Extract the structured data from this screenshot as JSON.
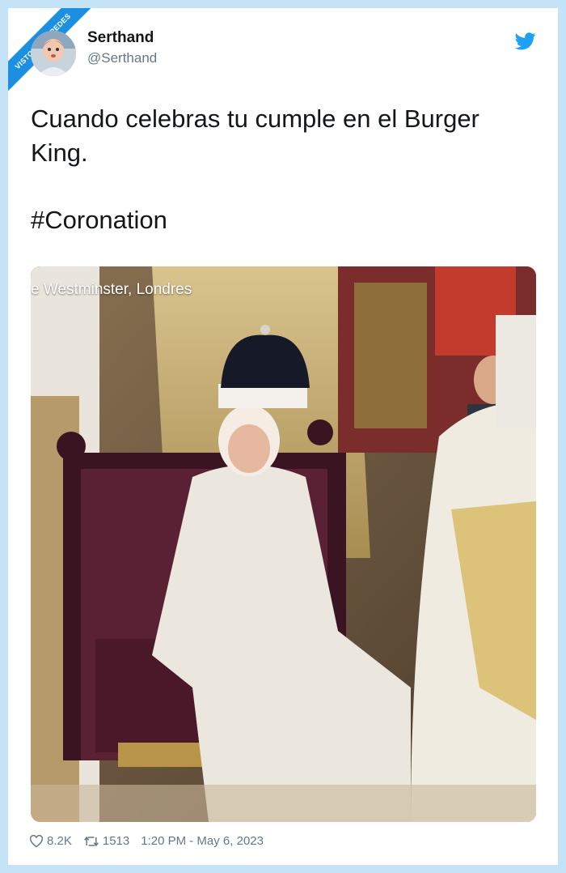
{
  "watermark": {
    "line1": "VISTOENLASREDES",
    "line2": ".com"
  },
  "user": {
    "name": "Serthand",
    "handle": "@Serthand"
  },
  "tweet": {
    "text": "Cuando celebras tu cumple en el Burger King.",
    "hashtag": "#Coronation"
  },
  "photo": {
    "overlay_caption": "e Westminster, Londres"
  },
  "footer": {
    "likes": "8.2K",
    "retweets": "1513",
    "time": "1:20 PM - May 6, 2023"
  },
  "colors": {
    "twitter_blue": "#1da1f2",
    "background": "#c5e3f7"
  }
}
